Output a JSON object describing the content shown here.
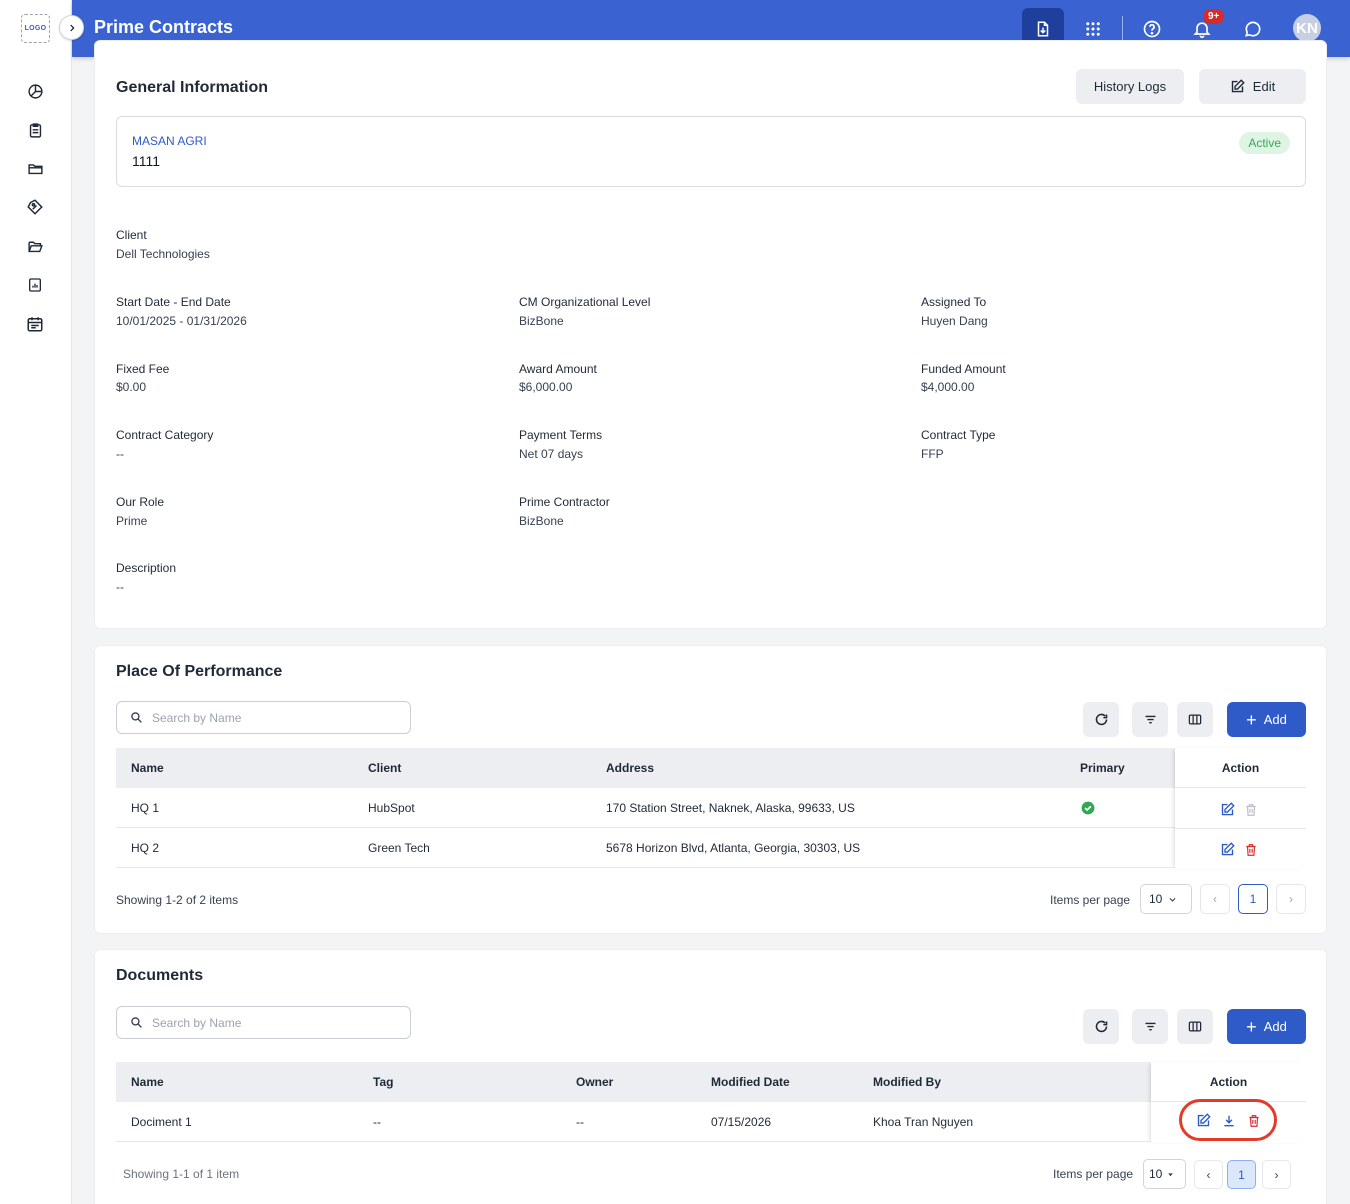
{
  "sidebar": {
    "logo_text": "LOGO",
    "nav_icons": [
      "dashboard-icon",
      "clipboard-icon",
      "folder-icon",
      "tag-icon",
      "folder-open-icon",
      "report-icon",
      "calendar-icon"
    ]
  },
  "topbar": {
    "title": "Prime Contracts",
    "notification_badge": "9+",
    "avatar_initials": "KN",
    "color": "#3a63d1"
  },
  "general": {
    "title": "General Information",
    "history_label": "History Logs",
    "edit_label": "Edit",
    "org_name": "MASAN AGRI",
    "org_id": "1111",
    "status": "Active",
    "fields": {
      "client_label": "Client",
      "client_value": "Dell Technologies",
      "dates_label": "Start Date - End Date",
      "dates_value": "10/01/2025 - 01/31/2026",
      "cm_label": "CM Organizational Level",
      "cm_value": "BizBone",
      "assigned_label": "Assigned To",
      "assigned_value": "Huyen Dang",
      "fixed_label": "Fixed Fee",
      "fixed_value": "$0.00",
      "award_label": "Award Amount",
      "award_value": "$6,000.00",
      "funded_label": "Funded Amount",
      "funded_value": "$4,000.00",
      "category_label": "Contract Category",
      "category_value": "--",
      "payment_label": "Payment Terms",
      "payment_value": "Net 07 days",
      "type_label": "Contract Type",
      "type_value": "FFP",
      "role_label": "Our Role",
      "role_value": "Prime",
      "prime_label": "Prime Contractor",
      "prime_value": "BizBone",
      "desc_label": "Description",
      "desc_value": "--"
    }
  },
  "pop": {
    "title": "Place Of Performance",
    "search_placeholder": "Search by Name",
    "add_label": "Add",
    "columns": {
      "name": "Name",
      "client": "Client",
      "address": "Address",
      "primary": "Primary",
      "action": "Action"
    },
    "rows": [
      {
        "name": "HQ 1",
        "client": "HubSpot",
        "address": "170 Station Street, Naknek, Alaska, 99633, US",
        "primary": true
      },
      {
        "name": "HQ 2",
        "client": "Green Tech",
        "address": "5678 Horizon Blvd, Atlanta, Georgia, 30303, US",
        "primary": false
      }
    ],
    "showing": "Showing 1-2 of 2 items",
    "items_per_page_label": "Items per page",
    "items_per_page": "10",
    "current_page": "1"
  },
  "docs": {
    "title": "Documents",
    "search_placeholder": "Search by Name",
    "add_label": "Add",
    "columns": {
      "name": "Name",
      "tag": "Tag",
      "owner": "Owner",
      "modified_date": "Modified Date",
      "modified_by": "Modified By",
      "action": "Action"
    },
    "rows": [
      {
        "name": "Dociment 1",
        "tag": "--",
        "owner": "--",
        "modified_date": "07/15/2026",
        "modified_by": "Khoa Tran Nguyen"
      }
    ],
    "showing": "Showing 1-1 of 1 item",
    "items_per_page_label": "Items per page",
    "items_per_page": "10",
    "current_page": "1"
  }
}
